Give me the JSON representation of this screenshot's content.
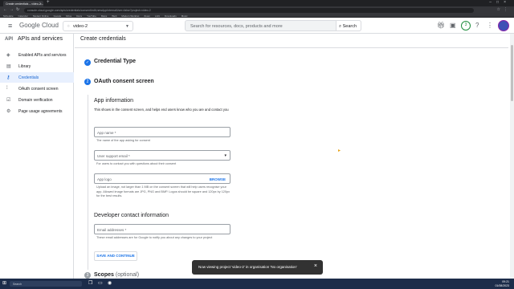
{
  "browser": {
    "tab_title": "Create credentials – video-2 –",
    "url": "console.cloud.google.com/apis/credentials/consent/edit;newAppInternalUser=false?project=video-2",
    "bookmarks": [
      "Schedule",
      "Calendar",
      "Student Online",
      "Google",
      "Drive",
      "Docs",
      "YouTube",
      "Maps",
      "Web",
      "Modern Working",
      "Zoom",
      "LAN",
      "Downloads",
      "Music"
    ]
  },
  "header": {
    "logo_text": "Google Cloud",
    "project": "video-2",
    "search_placeholder": "Search for resources, docs, products and more",
    "search_button": "Search",
    "notification_count": "3"
  },
  "sidebar": {
    "title_prefix": "API",
    "title": "APIs and services",
    "items": [
      {
        "label": "Enabled APIs and services",
        "icon": "grid-icon"
      },
      {
        "label": "Library",
        "icon": "library-icon"
      },
      {
        "label": "Credentials",
        "icon": "key-icon"
      },
      {
        "label": "OAuth consent screen",
        "icon": "consent-icon"
      },
      {
        "label": "Domain verification",
        "icon": "checkbox-icon"
      },
      {
        "label": "Page usage agreements",
        "icon": "settings-icon"
      }
    ],
    "active_index": 2
  },
  "main": {
    "page_title": "Create credentials",
    "steps": [
      {
        "number": "✓",
        "title": "Credential Type"
      },
      {
        "number": "2",
        "title": "OAuth consent screen"
      },
      {
        "number": "3",
        "title": "Scopes",
        "optional": "(optional)"
      }
    ],
    "app_info": {
      "heading": "App information",
      "description": "This shows in the consent screen, and helps end users know who you are and contact you",
      "app_name_label": "App name *",
      "app_name_hint": "The name of the app asking for consent",
      "support_email_label": "User support email *",
      "support_email_hint": "For users to contact you with questions about their consent",
      "logo_label": "App logo",
      "browse_label": "BROWSE",
      "logo_hint": "Upload an image, not larger than 1 MB on the consent screen that will help users recognise your app. Allowed image formats are JPG, PNG and BMP. Logos should be square and 120px by 120px for the best results."
    },
    "developer": {
      "heading": "Developer contact information",
      "email_label": "Email addresses *",
      "email_hint": "These email addresses are for Google to notify you about any changes to your project"
    },
    "save_button": "SAVE AND CONTINUE"
  },
  "snackbar": {
    "message": "Now viewing project 'video-2' in organisation 'No organisation'"
  },
  "taskbar": {
    "search_placeholder": "Search",
    "time": "09:21",
    "date": "01/08/2023"
  }
}
